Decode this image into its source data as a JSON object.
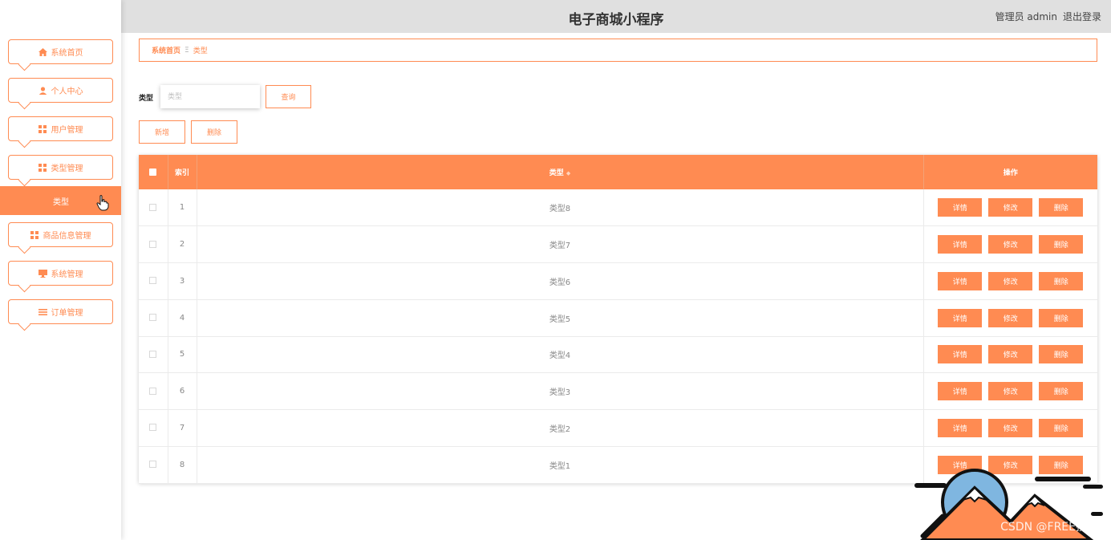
{
  "header": {
    "title": "电子商城小程序",
    "user_role": "管理员 admin",
    "logout_label": "退出登录"
  },
  "sidebar": {
    "items": [
      {
        "label": "系统首页",
        "icon": "home-icon"
      },
      {
        "label": "个人中心",
        "icon": "user-icon"
      },
      {
        "label": "用户管理",
        "icon": "grid-icon"
      },
      {
        "label": "类型管理",
        "icon": "grid-icon"
      },
      {
        "label": "商品信息管理",
        "icon": "grid-icon"
      },
      {
        "label": "系统管理",
        "icon": "monitor-icon"
      },
      {
        "label": "订单管理",
        "icon": "list-icon"
      }
    ],
    "active_submenu": "类型"
  },
  "breadcrumb": {
    "home": "系统首页",
    "separator": "Ξ",
    "current": "类型"
  },
  "search": {
    "label": "类型",
    "placeholder": "类型",
    "value": "",
    "query_button": "查询"
  },
  "actions": {
    "add_label": "新增",
    "delete_label": "删除"
  },
  "table": {
    "columns": [
      "索引",
      "类型",
      "操作"
    ],
    "rows": [
      {
        "index": "1",
        "type": "类型8"
      },
      {
        "index": "2",
        "type": "类型7"
      },
      {
        "index": "3",
        "type": "类型6"
      },
      {
        "index": "4",
        "type": "类型5"
      },
      {
        "index": "5",
        "type": "类型4"
      },
      {
        "index": "6",
        "type": "类型3"
      },
      {
        "index": "7",
        "type": "类型2"
      },
      {
        "index": "8",
        "type": "类型1"
      }
    ],
    "row_buttons": {
      "detail": "详情",
      "edit": "修改",
      "delete": "删除"
    }
  },
  "watermark": "CSDN @FREE技术",
  "colors": {
    "accent": "#ff8b52",
    "header_bg": "#e0e0e0"
  }
}
